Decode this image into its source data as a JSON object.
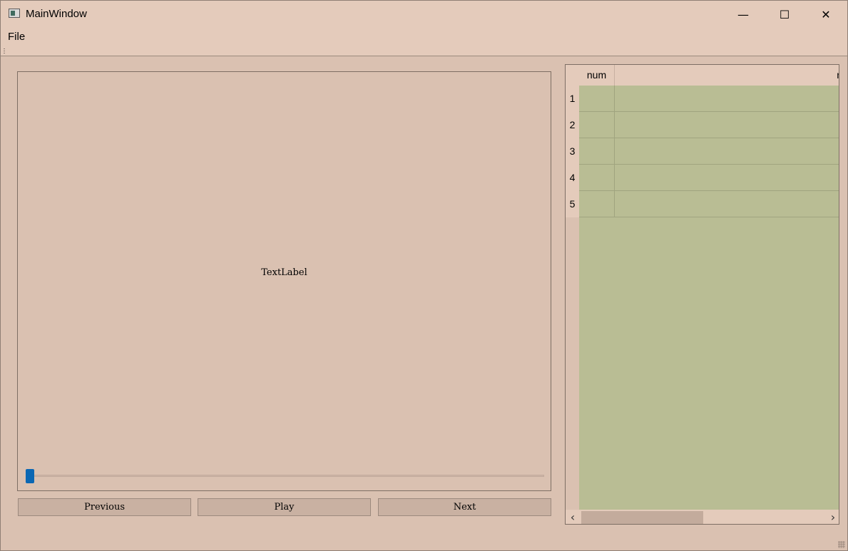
{
  "window": {
    "title": "MainWindow",
    "controls": {
      "minimize": "—",
      "maximize": "☐",
      "close": "✕"
    }
  },
  "menu": {
    "items": [
      "File"
    ]
  },
  "viewer": {
    "label": "TextLabel",
    "slider_value": 0
  },
  "buttons": {
    "previous": "Previous",
    "play": "Play",
    "next": "Next"
  },
  "table": {
    "headers": [
      "num",
      "n"
    ],
    "rows": [
      "1",
      "2",
      "3",
      "4",
      "5"
    ]
  },
  "scrollbar": {
    "left_arrow": "‹",
    "right_arrow": "›"
  },
  "colors": {
    "background": "#dac1b1",
    "chrome": "#e4cbbb",
    "cells": "#b9bd94",
    "slider_handle": "#0b67b3"
  }
}
